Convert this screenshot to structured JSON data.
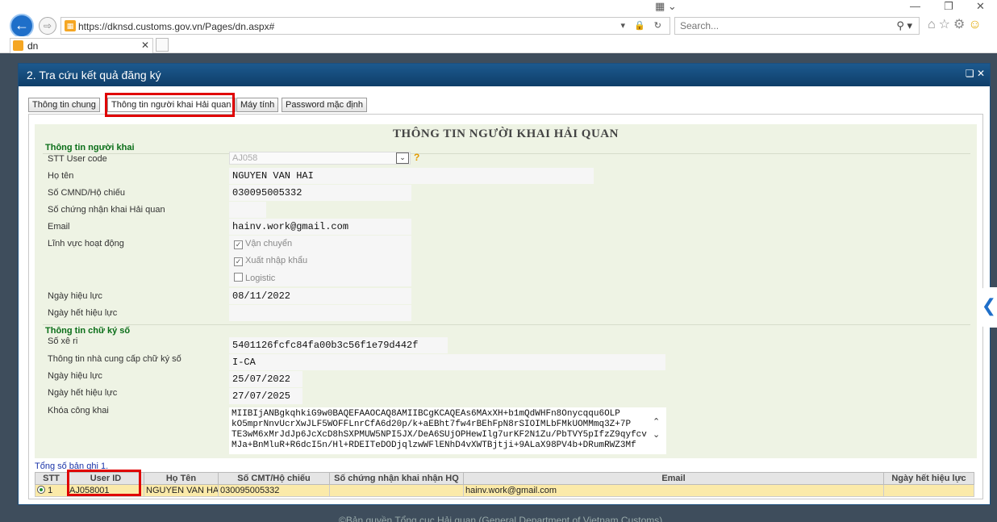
{
  "browser": {
    "url": "https://dknsd.customs.gov.vn/Pages/dn.aspx#",
    "search_placeholder": "Search...",
    "tab_title": "dn"
  },
  "modal": {
    "title": "2. Tra cứu kết quả đăng ký",
    "tabs": [
      "Thông tin chung",
      "Thông tin người khai Hải quan",
      "Máy tính",
      "Password mặc định"
    ],
    "form_title": "THÔNG TIN NGƯỜI KHAI HẢI QUAN",
    "section1": "Thông tin người khai",
    "section2": "Thông tin chữ ký số",
    "labels": {
      "user_code": "STT User code",
      "full_name": "Họ tên",
      "id_number": "Số CMND/Hộ chiếu",
      "cert_number": "Số chứng nhận khai Hải quan",
      "email": "Email",
      "field": "Lĩnh vực hoạt động",
      "effective_date": "Ngày hiệu lực",
      "expiry_date": "Ngày hết hiệu lực",
      "serial": "Số xê ri",
      "provider": "Thông tin nhà cung cấp chữ ký số",
      "sig_effective_date": "Ngày hiệu lực",
      "sig_expiry_date": "Ngày hết hiệu lực",
      "public_key": "Khóa công khai"
    },
    "values": {
      "user_code": "AJ058",
      "full_name": "NGUYEN VAN HAI",
      "id_number": "030095005332",
      "cert_number": "",
      "email": "hainv.work@gmail.com",
      "effective_date": "08/11/2022",
      "expiry_date": "",
      "serial": "5401126fcfc84fa00b3c56f1e79d442f",
      "provider": "I-CA",
      "sig_effective_date": "25/07/2022",
      "sig_expiry_date": "27/07/2025",
      "public_key": "MIIBIjANBgkqhkiG9w0BAQEFAAOCAQ8AMIIBCgKCAQEAs6MAxXH+b1mQdWHFn8Onycqqu6OLP\nkO5mprNnvUcrXwJLF5WOFFLnrCfA6d20p/k+aEBht7fw4rBEhFpN8rSIOIMLbFMkUOMMmq3Z+7P\nTE3wM6xMrJdJp6JcXcD8hSXPMUW5NPI5JX/DeA6SUjOPHewIlg7urKF2N1Zu/PbTVY5pIfzZ9qyfcv\nMJa+BnMluR+R6dcI5n/Hl+RDEITeDODjqlzwWFlENhD4vXWTBjtji+9ALaX98PV4b+DRumRWZ3Mf"
    },
    "field_options": [
      {
        "label": "Vận chuyển",
        "checked": true
      },
      {
        "label": "Xuất nhập khẩu",
        "checked": true
      },
      {
        "label": "Logistic",
        "checked": false
      }
    ],
    "total_records": "Tổng số bản ghi 1.",
    "table": {
      "headers": [
        "STT",
        "User ID",
        "Họ Tên",
        "Số CMT/Hộ chiếu",
        "Số chứng nhận khai nhận HQ",
        "Email",
        "Ngày hết hiệu lực"
      ],
      "rows": [
        {
          "stt": "1",
          "user_id": "AJ058001",
          "name": "NGUYEN VAN HAI",
          "id": "030095005332",
          "cert": "",
          "email": "hainv.work@gmail.com",
          "expiry": ""
        }
      ]
    }
  },
  "footer": "©Bản quyền Tổng cục Hải quan (General Department of Vietnam Customs)",
  "colors": {
    "highlight": "#e00000",
    "section_green": "#0a6e18",
    "row_yellow": "#fbeaa9",
    "header_blue": "#1c5a8f"
  }
}
